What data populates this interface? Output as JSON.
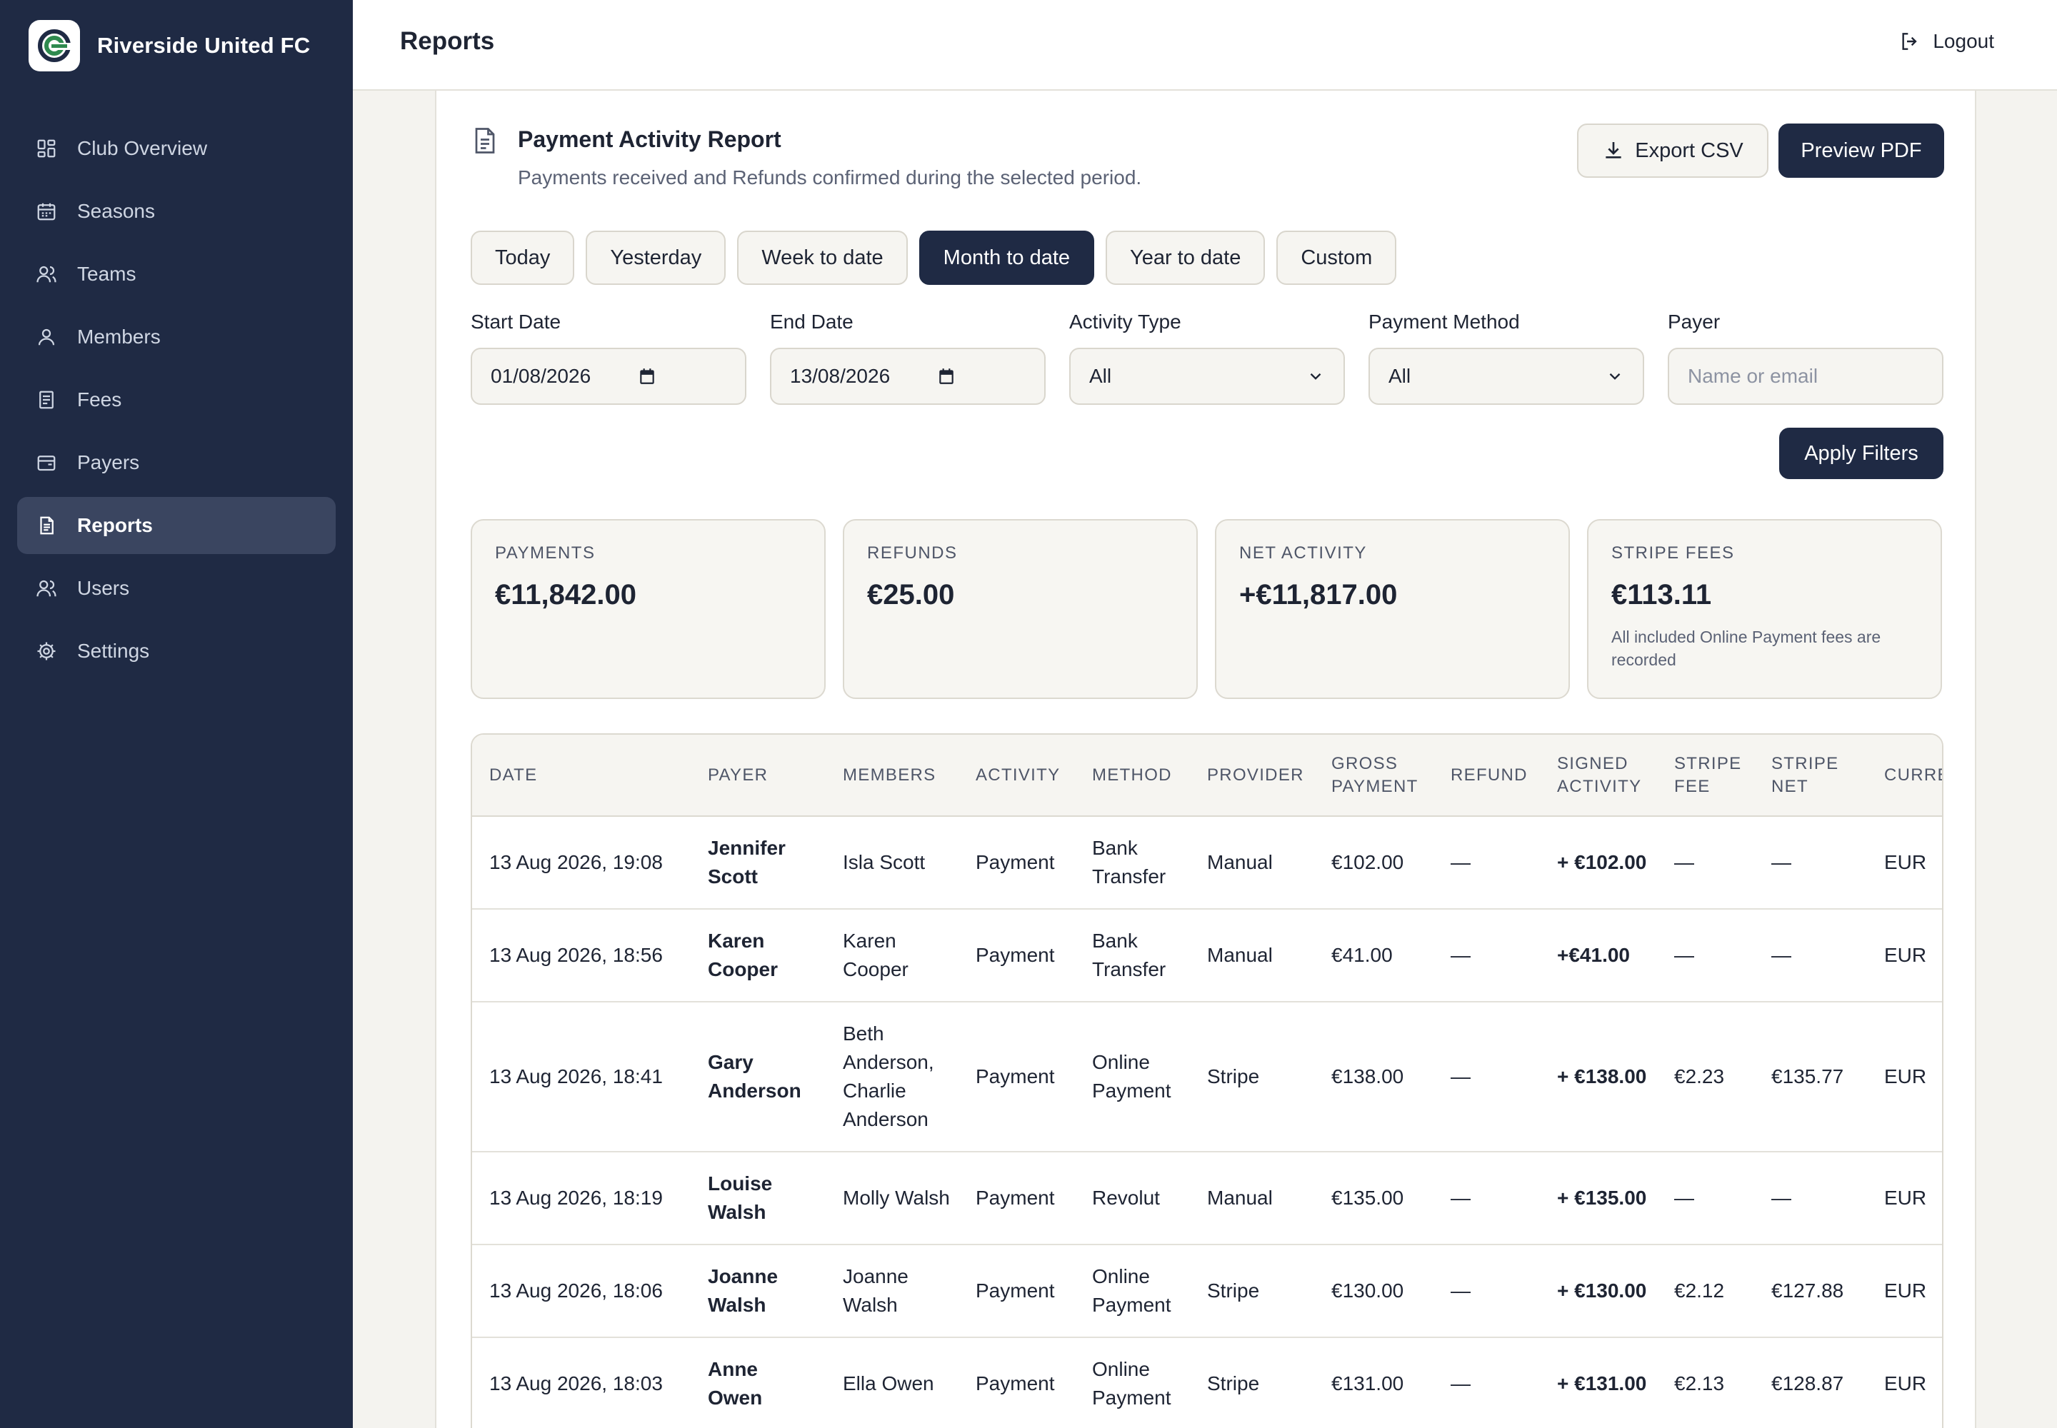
{
  "app": {
    "club_name": "Riverside United FC",
    "logo_icon": "club-logo-icon",
    "accent_color": "#1f2a44"
  },
  "sidebar": {
    "items": [
      {
        "label": "Club Overview",
        "icon": "grid-icon",
        "active": false
      },
      {
        "label": "Seasons",
        "icon": "calendar-icon",
        "active": false
      },
      {
        "label": "Teams",
        "icon": "users-icon",
        "active": false
      },
      {
        "label": "Members",
        "icon": "user-icon",
        "active": false
      },
      {
        "label": "Fees",
        "icon": "receipt-icon",
        "active": false
      },
      {
        "label": "Payers",
        "icon": "wallet-icon",
        "active": false
      },
      {
        "label": "Reports",
        "icon": "document-icon",
        "active": true
      },
      {
        "label": "Users",
        "icon": "users-icon",
        "active": false
      },
      {
        "label": "Settings",
        "icon": "gear-icon",
        "active": false
      }
    ]
  },
  "header": {
    "title": "Reports",
    "logout_label": "Logout"
  },
  "report": {
    "title": "Payment Activity Report",
    "subtitle": "Payments received and Refunds confirmed during the selected period.",
    "export_label": "Export CSV",
    "preview_label": "Preview PDF",
    "ranges": [
      {
        "label": "Today",
        "active": false
      },
      {
        "label": "Yesterday",
        "active": false
      },
      {
        "label": "Week to date",
        "active": false
      },
      {
        "label": "Month to date",
        "active": true
      },
      {
        "label": "Year to date",
        "active": false
      },
      {
        "label": "Custom",
        "active": false
      }
    ]
  },
  "filters": {
    "start_date": {
      "label": "Start Date",
      "value": "01/08/2026"
    },
    "end_date": {
      "label": "End Date",
      "value": "13/08/2026"
    },
    "activity_type": {
      "label": "Activity Type",
      "value": "All"
    },
    "payment_method": {
      "label": "Payment Method",
      "value": "All"
    },
    "payer": {
      "label": "Payer",
      "placeholder": "Name or email"
    },
    "apply_label": "Apply Filters"
  },
  "stats": [
    {
      "label": "Payments",
      "value": "€11,842.00",
      "note": ""
    },
    {
      "label": "Refunds",
      "value": "€25.00",
      "note": ""
    },
    {
      "label": "Net Activity",
      "value": "+€11,817.00",
      "note": ""
    },
    {
      "label": "Stripe Fees",
      "value": "€113.11",
      "note": "All included Online Payment fees are recorded"
    }
  ],
  "table": {
    "columns": [
      "Date",
      "Payer",
      "Members",
      "Activity",
      "Method",
      "Provider",
      "Gross Payment",
      "Refund",
      "Signed Activity",
      "Stripe Fee",
      "Stripe Net",
      "Currency"
    ],
    "rows": [
      {
        "date": "13 Aug 2026, 19:08",
        "payer": "Jennifer Scott",
        "members": "Isla Scott",
        "activity": "Payment",
        "method": "Bank Transfer",
        "provider": "Manual",
        "gross": "€102.00",
        "refund": "—",
        "signed": "+ €102.00",
        "fee": "—",
        "net": "—",
        "currency": "EUR"
      },
      {
        "date": "13 Aug 2026, 18:56",
        "payer": "Karen Cooper",
        "members": "Karen Cooper",
        "activity": "Payment",
        "method": "Bank Transfer",
        "provider": "Manual",
        "gross": "€41.00",
        "refund": "—",
        "signed": "+€41.00",
        "fee": "—",
        "net": "—",
        "currency": "EUR"
      },
      {
        "date": "13 Aug 2026, 18:41",
        "payer": "Gary Anderson",
        "members": "Beth Anderson, Charlie Anderson",
        "activity": "Payment",
        "method": "Online Payment",
        "provider": "Stripe",
        "gross": "€138.00",
        "refund": "—",
        "signed": "+ €138.00",
        "fee": "€2.23",
        "net": "€135.77",
        "currency": "EUR"
      },
      {
        "date": "13 Aug 2026, 18:19",
        "payer": "Louise Walsh",
        "members": "Molly Walsh",
        "activity": "Payment",
        "method": "Revolut",
        "provider": "Manual",
        "gross": "€135.00",
        "refund": "—",
        "signed": "+ €135.00",
        "fee": "—",
        "net": "—",
        "currency": "EUR"
      },
      {
        "date": "13 Aug 2026, 18:06",
        "payer": "Joanne Walsh",
        "members": "Joanne Walsh",
        "activity": "Payment",
        "method": "Online Payment",
        "provider": "Stripe",
        "gross": "€130.00",
        "refund": "—",
        "signed": "+ €130.00",
        "fee": "€2.12",
        "net": "€127.88",
        "currency": "EUR"
      },
      {
        "date": "13 Aug 2026, 18:03",
        "payer": "Anne Owen",
        "members": "Ella Owen",
        "activity": "Payment",
        "method": "Online Payment",
        "provider": "Stripe",
        "gross": "€131.00",
        "refund": "—",
        "signed": "+ €131.00",
        "fee": "€2.13",
        "net": "€128.87",
        "currency": "EUR"
      }
    ]
  }
}
